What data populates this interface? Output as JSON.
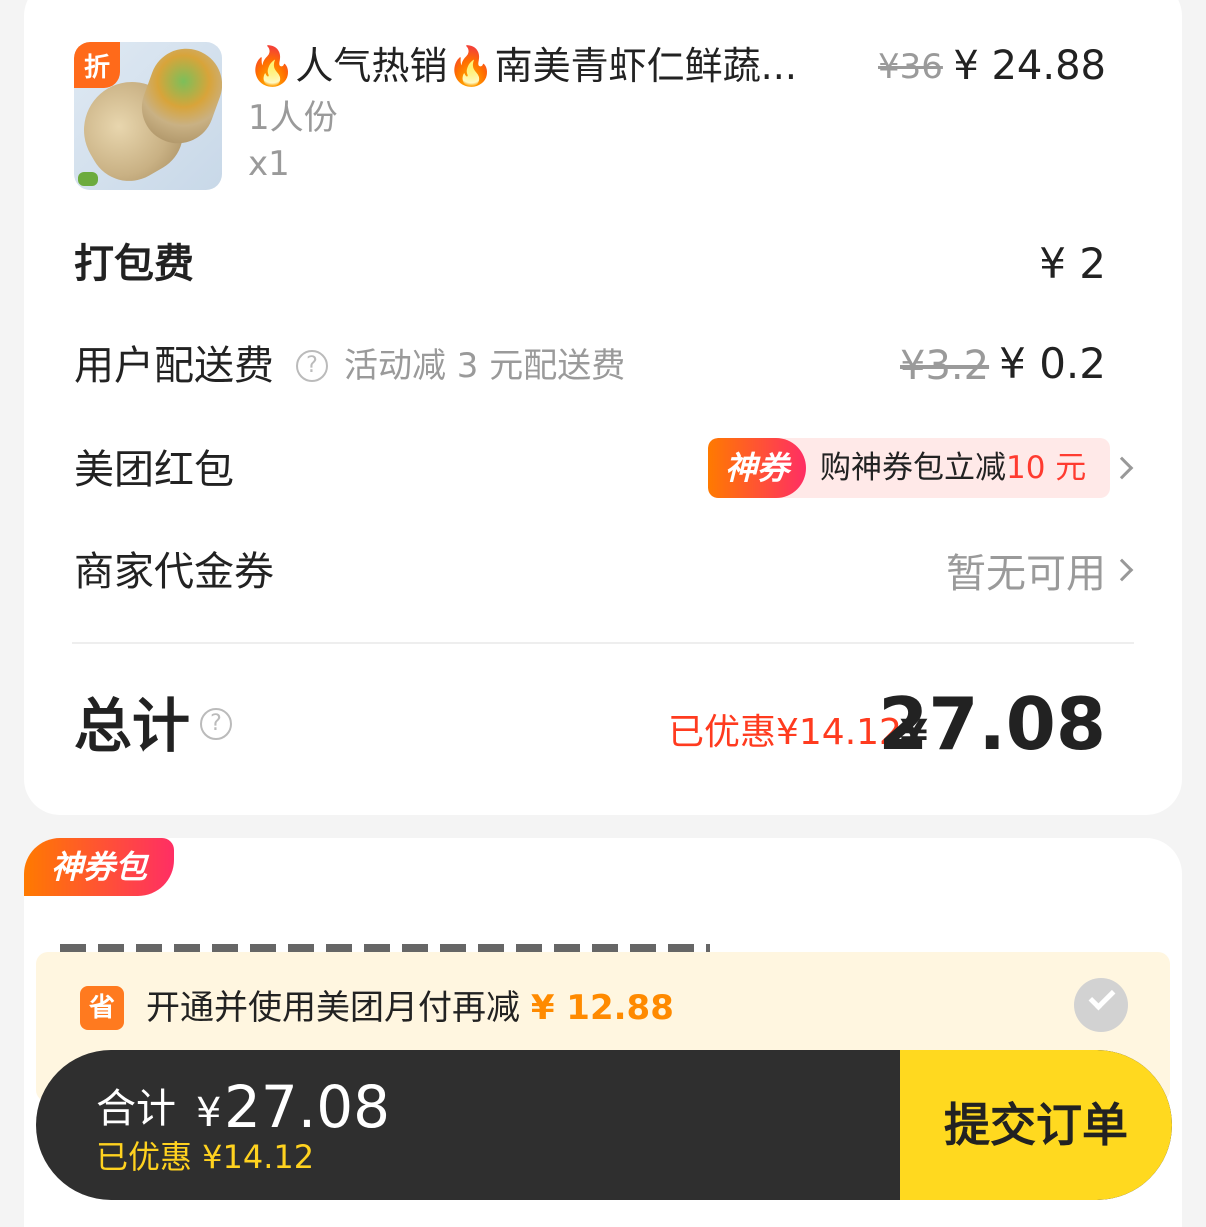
{
  "product": {
    "badge": "折",
    "title_prefix": "🔥",
    "title_part1": "人气热销",
    "title_mid": "🔥",
    "title_part2": "南美青虾仁鲜蔬...",
    "original_price": "¥36",
    "price": "¥ 24.88",
    "spec": "1人份",
    "quantity": "x1"
  },
  "packing": {
    "label": "打包费",
    "value": "¥ 2"
  },
  "delivery": {
    "label": "用户配送费",
    "help": "?",
    "activity": "活动减 3 元配送费",
    "original": "¥3.2",
    "value": "¥ 0.2"
  },
  "red_packet": {
    "label": "美团红包",
    "tag": "神券",
    "text": "购神券包立减",
    "amount": "10 元"
  },
  "voucher": {
    "label": "商家代金券",
    "status": "暂无可用"
  },
  "total": {
    "label": "总计",
    "help": "?",
    "saved": "已优惠¥14.12",
    "yen": "¥",
    "amount": "27.08"
  },
  "shenquan_pack": {
    "tag": "神券包"
  },
  "monthly": {
    "icon": "省",
    "text": "开通并使用美团月付再减",
    "amount": "¥ 12.88"
  },
  "bottom_bar": {
    "label": "合计",
    "yen": "¥",
    "amount": "27.08",
    "saved": "已优惠 ¥14.12",
    "submit": "提交订单"
  },
  "colors": {
    "accent_orange": "#ff7a00",
    "accent_red": "#ff3b30",
    "submit_yellow": "#ffd91f",
    "bar_dark": "#2f2f2f"
  }
}
